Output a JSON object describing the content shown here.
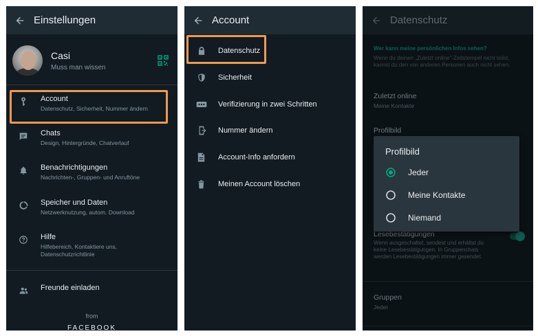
{
  "panel1": {
    "title": "Einstellungen",
    "profile": {
      "name": "Casi",
      "status": "Muss man wissen"
    },
    "items": [
      {
        "label": "Account",
        "sub": "Datenschutz, Sicherheit, Nummer ändern",
        "icon": "key-icon"
      },
      {
        "label": "Chats",
        "sub": "Design, Hintergründe, Chatverlauf",
        "icon": "chat-icon"
      },
      {
        "label": "Benachrichtigungen",
        "sub": "Nachrichten-, Gruppen- und Anruftöne",
        "icon": "bell-icon"
      },
      {
        "label": "Speicher und Daten",
        "sub": "Netzwerknutzung, autom. Download",
        "icon": "data-usage-icon"
      },
      {
        "label": "Hilfe",
        "sub": "Hilfebereich, Kontaktiere uns,\nDatenschutzrichtlinie",
        "icon": "help-icon"
      }
    ],
    "invite": "Freunde einladen",
    "from": "from",
    "brand": "FACEBOOK"
  },
  "panel2": {
    "title": "Account",
    "items": [
      {
        "label": "Datenschutz",
        "icon": "lock-icon"
      },
      {
        "label": "Sicherheit",
        "icon": "shield-icon"
      },
      {
        "label": "Verifizierung in zwei Schritten",
        "icon": "password-dots-icon"
      },
      {
        "label": "Nummer ändern",
        "icon": "phone-change-icon"
      },
      {
        "label": "Account-Info anfordern",
        "icon": "document-icon"
      },
      {
        "label": "Meinen Account löschen",
        "icon": "trash-icon"
      }
    ]
  },
  "panel3": {
    "title": "Datenschutz",
    "section_header": "Wer kann meine persönlichen Infos sehen?",
    "section_desc": "Wenn du deinen „Zuletzt online\"-Zeitstempel nicht teilst, kannst du den von anderen Personen auch nicht sehen.",
    "last_seen": {
      "label": "Zuletzt online",
      "value": "Meine Kontakte"
    },
    "profile_photo": {
      "label": "Profilbild"
    },
    "read_receipts": {
      "label": "Lesebestätigungen",
      "desc": "Wenn ausgeschaltet, sendest und erhältst du keine Lesebestätigungen. In Gruppenchats werden Lesebestätigungen immer gesendet."
    },
    "groups": {
      "label": "Gruppen",
      "value": "Jeder"
    },
    "dialog": {
      "title": "Profilbild",
      "options": [
        "Jeder",
        "Meine Kontakte",
        "Niemand"
      ],
      "selected": "Jeder"
    }
  },
  "colors": {
    "accent": "#00a884",
    "highlight": "#f09a4e",
    "background": "#121b22",
    "appbar": "#1f2c34"
  }
}
